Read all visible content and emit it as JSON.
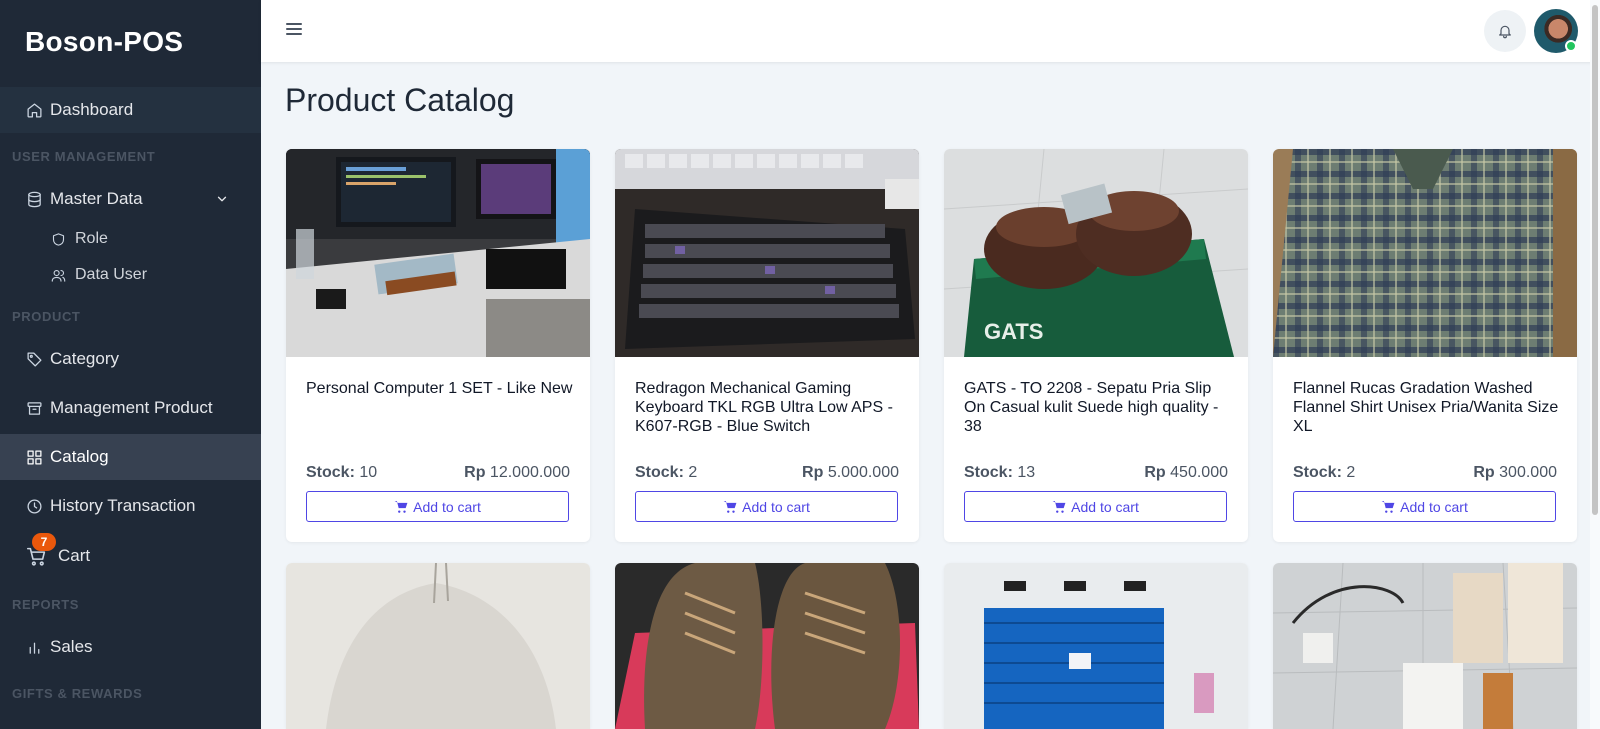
{
  "app": {
    "brand": "Boson-POS"
  },
  "sidebar": {
    "dashboard": "Dashboard",
    "sections": {
      "user_management": "USER MANAGEMENT",
      "product": "PRODUCT",
      "reports": "REPORTS",
      "gifts_rewards": "GIFTS & REWARDS"
    },
    "master_data": "Master Data",
    "role": "Role",
    "data_user": "Data User",
    "category": "Category",
    "management_product": "Management Product",
    "catalog": "Catalog",
    "history_transaction": "History Transaction",
    "cart": "Cart",
    "cart_count": "7",
    "sales": "Sales",
    "active_item": "Catalog"
  },
  "header": {
    "title": "Product Catalog"
  },
  "colors": {
    "sidebar_bg": "#1f2937",
    "accent": "#4f46e5",
    "badge": "#ea580c",
    "online": "#22c55e"
  },
  "products": [
    {
      "name": "Personal Computer 1 SET - Like New",
      "stock_label": "Stock:",
      "stock": "10",
      "currency": "Rp",
      "price": "12.000.000",
      "button": "Add to cart"
    },
    {
      "name": "Redragon Mechanical Gaming Keyboard TKL RGB Ultra Low APS - K607-RGB - Blue Switch",
      "stock_label": "Stock:",
      "stock": "2",
      "currency": "Rp",
      "price": "5.000.000",
      "button": "Add to cart"
    },
    {
      "name": "GATS - TO 2208 - Sepatu Pria Slip On Casual kulit Suede high quality - 38",
      "stock_label": "Stock:",
      "stock": "13",
      "currency": "Rp",
      "price": "450.000",
      "button": "Add to cart"
    },
    {
      "name": "Flannel Rucas Gradation Washed Flannel Shirt Unisex Pria/Wanita Size XL",
      "stock_label": "Stock:",
      "stock": "2",
      "currency": "Rp",
      "price": "300.000",
      "button": "Add to cart"
    }
  ]
}
